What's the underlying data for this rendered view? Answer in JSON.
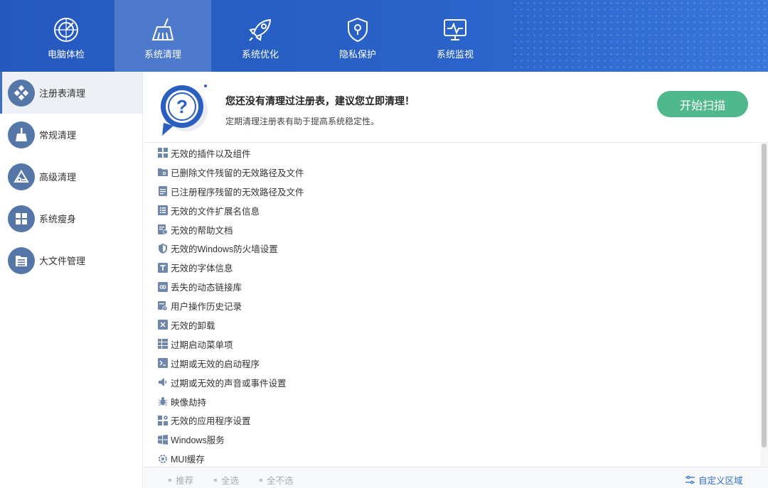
{
  "nav": {
    "tabs": [
      {
        "label": "电脑体检",
        "icon": "radar-icon"
      },
      {
        "label": "系统清理",
        "icon": "broom-icon",
        "active": true
      },
      {
        "label": "系统优化",
        "icon": "rocket-icon"
      },
      {
        "label": "隐私保护",
        "icon": "shield-lock-icon"
      },
      {
        "label": "系统监视",
        "icon": "monitor-pulse-icon"
      }
    ]
  },
  "sidebar": {
    "items": [
      {
        "label": "注册表清理",
        "icon": "registry-icon",
        "active": true
      },
      {
        "label": "常规清理",
        "icon": "broom-icon"
      },
      {
        "label": "高级清理",
        "icon": "advanced-clean-icon"
      },
      {
        "label": "系统瘦身",
        "icon": "windows-icon"
      },
      {
        "label": "大文件管理",
        "icon": "folder-list-icon"
      }
    ]
  },
  "banner": {
    "title": "您还没有清理过注册表，建议您立即清理！",
    "subtitle": "定期清理注册表有助于提高系统稳定性。",
    "scan_button": "开始扫描",
    "icon": "question-bubble-icon"
  },
  "list": {
    "items": [
      {
        "label": "无效的插件以及组件",
        "icon": "grid-icon"
      },
      {
        "label": "已删除文件残留的无效路径及文件",
        "icon": "folder-link-icon"
      },
      {
        "label": "已注册程序残留的无效路径及文件",
        "icon": "document-icon"
      },
      {
        "label": "无效的文件扩展名信息",
        "icon": "list-icon"
      },
      {
        "label": "无效的帮助文档",
        "icon": "help-doc-icon"
      },
      {
        "label": "无效的Windows防火墙设置",
        "icon": "firewall-shield-icon"
      },
      {
        "label": "无效的字体信息",
        "icon": "font-icon"
      },
      {
        "label": "丢失的动态链接库",
        "icon": "dll-icon"
      },
      {
        "label": "用户操作历史记录",
        "icon": "history-icon"
      },
      {
        "label": "无效的卸载",
        "icon": "uninstall-icon"
      },
      {
        "label": "过期启动菜单项",
        "icon": "start-menu-icon"
      },
      {
        "label": "过期或无效的启动程序",
        "icon": "terminal-icon"
      },
      {
        "label": "过期或无效的声音或事件设置",
        "icon": "speaker-icon"
      },
      {
        "label": "映像劫持",
        "icon": "bug-icon"
      },
      {
        "label": "无效的应用程序设置",
        "icon": "app-settings-icon"
      },
      {
        "label": "Windows服务",
        "icon": "windows-icon"
      },
      {
        "label": "MUI缓存",
        "icon": "cache-icon"
      }
    ]
  },
  "footer": {
    "recommend": "推荐",
    "select_all": "全选",
    "select_none": "全不选",
    "custom_area": "自定义区域"
  },
  "colors": {
    "header_bg": "#2a60c6",
    "accent_green": "#4fb88d",
    "sidebar_icon_bg": "#5577a8",
    "list_icon": "#6f87a9",
    "link_blue": "#2f6fcf"
  }
}
